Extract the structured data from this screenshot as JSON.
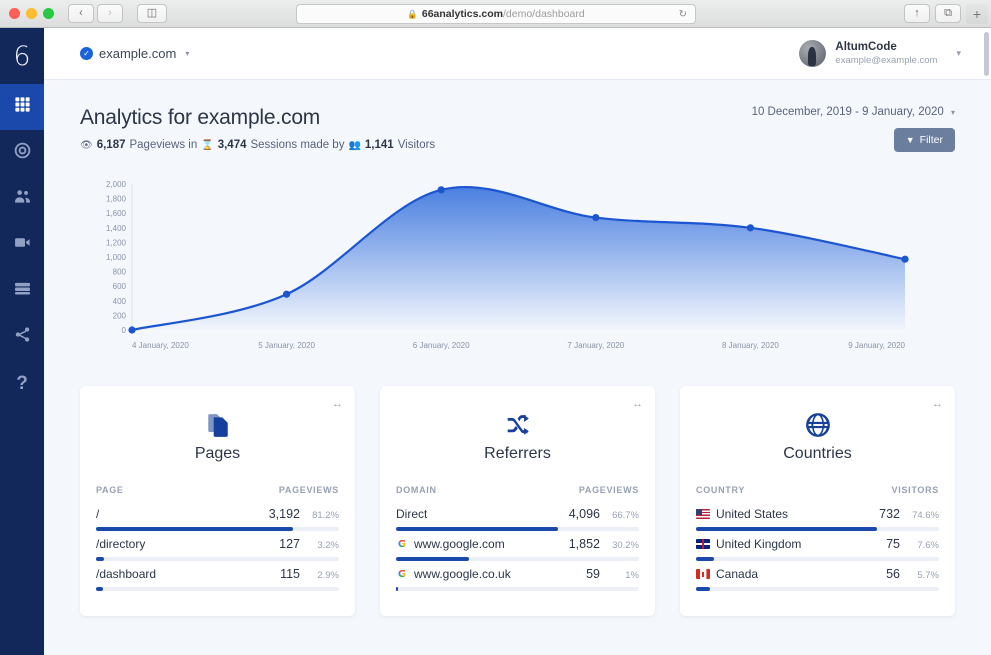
{
  "browser": {
    "back_label": "‹",
    "forward_label": "›",
    "sidebar_toggle_label": "◫",
    "url_secure": "66analytics.com",
    "url_path": "/demo/dashboard",
    "lock_icon": "🔒",
    "reload_label": "↻",
    "share_label": "↑",
    "tabs_label": "⧉",
    "newtab_label": "+"
  },
  "sidebar": {
    "logo": "6",
    "items": [
      {
        "name": "dashboard",
        "icon": "grid-icon",
        "active": true
      },
      {
        "name": "goals",
        "icon": "target-icon",
        "active": false
      },
      {
        "name": "visitors",
        "icon": "users-icon",
        "active": false
      },
      {
        "name": "recordings",
        "icon": "video-icon",
        "active": false
      },
      {
        "name": "events",
        "icon": "server-icon",
        "active": false
      },
      {
        "name": "share",
        "icon": "share-icon",
        "active": false
      },
      {
        "name": "help",
        "icon": "question-icon",
        "active": false
      }
    ]
  },
  "topbar": {
    "site_name": "example.com",
    "verified_icon": "✓",
    "caret": "▾",
    "account_name": "AltumCode",
    "account_email": "example@example.com",
    "account_caret": "▾"
  },
  "page": {
    "title": "Analytics for example.com",
    "pageviews_icon": "👁",
    "pageviews_value": "6,187",
    "pageviews_label": "Pageviews in",
    "sessions_icon": "⌛",
    "sessions_value": "3,474",
    "sessions_label": "Sessions made by",
    "visitors_icon": "👥",
    "visitors_value": "1,141",
    "visitors_label": "Visitors",
    "date_range": "10 December, 2019 - 9 January, 2020",
    "date_caret": "▾",
    "filter_label": "Filter",
    "filter_icon": "▼"
  },
  "chart_data": {
    "type": "area",
    "title": "",
    "xlabel": "",
    "ylabel": "",
    "x": [
      "4 January, 2020",
      "5 January, 2020",
      "6 January, 2020",
      "7 January, 2020",
      "8 January, 2020",
      "9 January, 2020"
    ],
    "series": [
      {
        "name": "Pageviews",
        "values": [
          0,
          490,
          1920,
          1540,
          1400,
          970
        ]
      }
    ],
    "ylim": [
      0,
      2000
    ],
    "yticks": [
      2000,
      1800,
      1600,
      1400,
      1200,
      1000,
      800,
      600,
      400,
      200,
      0
    ],
    "ytick_labels": [
      "2,000",
      "1,800",
      "1,600",
      "1,400",
      "1,200",
      "1,000",
      "800",
      "600",
      "400",
      "200",
      "0"
    ],
    "grid": false,
    "legend": "none",
    "line_color": "#1b55d0",
    "fill_color_top": "#4a7fe0",
    "fill_color_bottom": "#f2f6fd"
  },
  "cards": [
    {
      "name": "pages",
      "icon": "documents-icon",
      "title": "Pages",
      "expand_icon": "↔",
      "col_left": "PAGE",
      "col_right": "PAGEVIEWS",
      "rows": [
        {
          "label": "/",
          "value": "3,192",
          "pct": "81.2%",
          "bar": 81.2,
          "flag": "",
          "gicon": ""
        },
        {
          "label": "/directory",
          "value": "127",
          "pct": "3.2%",
          "bar": 3.2,
          "flag": "",
          "gicon": ""
        },
        {
          "label": "/dashboard",
          "value": "115",
          "pct": "2.9%",
          "bar": 2.9,
          "flag": "",
          "gicon": ""
        }
      ]
    },
    {
      "name": "referrers",
      "icon": "shuffle-icon",
      "title": "Referrers",
      "expand_icon": "↔",
      "col_left": "DOMAIN",
      "col_right": "PAGEVIEWS",
      "rows": [
        {
          "label": "Direct",
          "value": "4,096",
          "pct": "66.7%",
          "bar": 66.7,
          "flag": "",
          "gicon": ""
        },
        {
          "label": "www.google.com",
          "value": "1,852",
          "pct": "30.2%",
          "bar": 30.2,
          "flag": "",
          "gicon": "G"
        },
        {
          "label": "www.google.co.uk",
          "value": "59",
          "pct": "1%",
          "bar": 1,
          "flag": "",
          "gicon": "G"
        }
      ]
    },
    {
      "name": "countries",
      "icon": "globe-icon",
      "title": "Countries",
      "expand_icon": "↔",
      "col_left": "COUNTRY",
      "col_right": "VISITORS",
      "rows": [
        {
          "label": "United States",
          "value": "732",
          "pct": "74.6%",
          "bar": 74.6,
          "flag": "us",
          "gicon": ""
        },
        {
          "label": "United Kingdom",
          "value": "75",
          "pct": "7.6%",
          "bar": 7.6,
          "flag": "uk",
          "gicon": ""
        },
        {
          "label": "Canada",
          "value": "56",
          "pct": "5.7%",
          "bar": 5.7,
          "flag": "ca",
          "gicon": ""
        }
      ]
    }
  ]
}
